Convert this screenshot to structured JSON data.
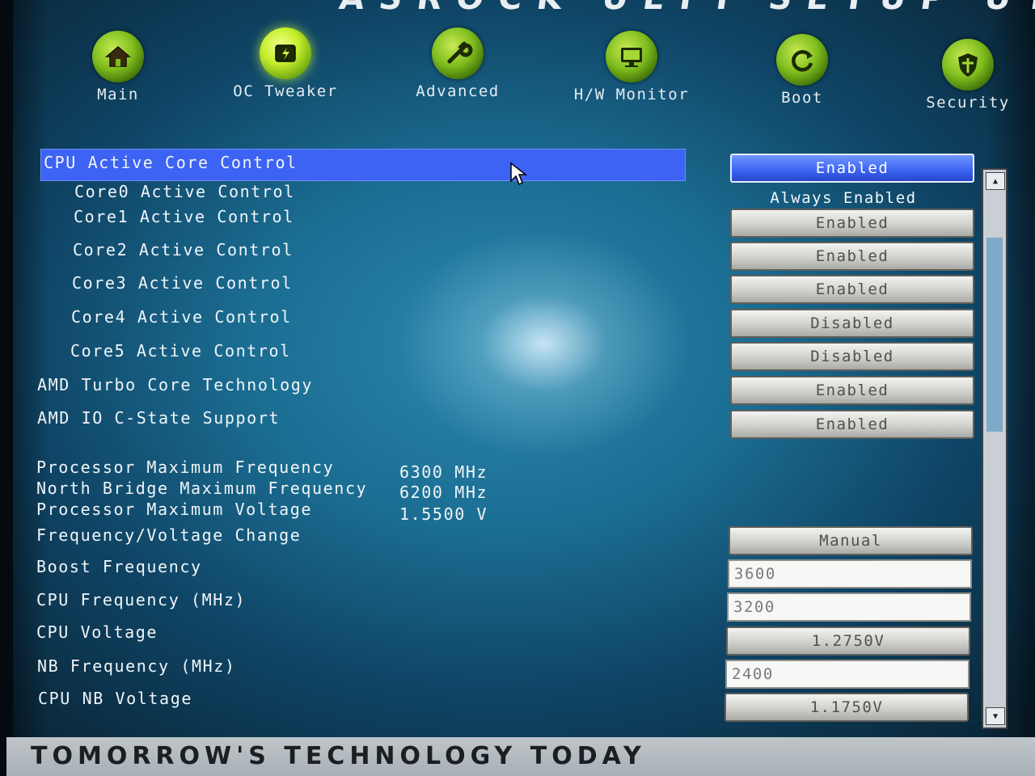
{
  "window_title": "ASROCK UEFI SETUP UTI",
  "nav": [
    {
      "label": "Main",
      "icon": "home-icon",
      "active": false
    },
    {
      "label": "OC Tweaker",
      "icon": "oc-tweaker-icon",
      "active": true
    },
    {
      "label": "Advanced",
      "icon": "wrench-icon",
      "active": false
    },
    {
      "label": "H/W Monitor",
      "icon": "monitor-icon",
      "active": false
    },
    {
      "label": "Boot",
      "icon": "refresh-icon",
      "active": false
    },
    {
      "label": "Security",
      "icon": "shield-icon",
      "active": false
    }
  ],
  "settings": [
    {
      "label": "CPU Active Core Control",
      "value": "Enabled"
    },
    {
      "label": "Core0 Active Control",
      "value": "Always Enabled"
    },
    {
      "label": "Core1 Active Control",
      "value": "Enabled"
    },
    {
      "label": "Core2 Active Control",
      "value": "Enabled"
    },
    {
      "label": "Core3 Active Control",
      "value": "Enabled"
    },
    {
      "label": "Core4 Active Control",
      "value": "Disabled"
    },
    {
      "label": "Core5 Active Control",
      "value": "Disabled"
    },
    {
      "label": "AMD Turbo Core Technology",
      "value": "Enabled"
    },
    {
      "label": "AMD IO C-State Support",
      "value": "Enabled"
    }
  ],
  "info": [
    {
      "label": "Processor Maximum Frequency",
      "value": "6300 MHz"
    },
    {
      "label": "North Bridge Maximum Frequency",
      "value": "6200 MHz"
    },
    {
      "label": "Processor Maximum Voltage",
      "value": "1.5500 V"
    }
  ],
  "freq_settings": [
    {
      "label": "Frequency/Voltage Change",
      "value": "Manual"
    },
    {
      "label": "Boost Frequency",
      "value": "3600"
    },
    {
      "label": "CPU Frequency (MHz)",
      "value": "3200"
    },
    {
      "label": "CPU Voltage",
      "value": "1.2750V"
    },
    {
      "label": "NB Frequency (MHz)",
      "value": "2400"
    },
    {
      "label": "CPU NB Voltage",
      "value": "1.1750V"
    }
  ],
  "footer_text": "TOMORROW'S TECHNOLOGY TODAY",
  "accent_color": "#3c63f3"
}
